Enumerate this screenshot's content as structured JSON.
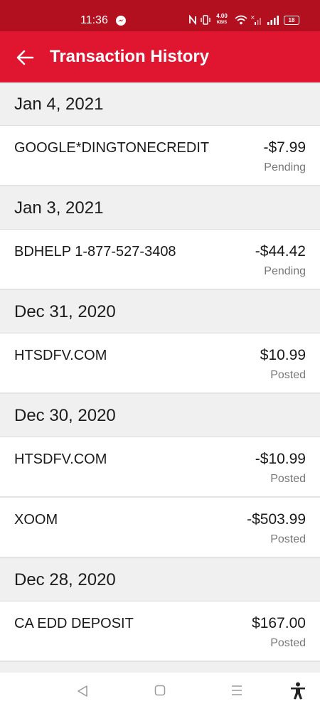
{
  "status_bar": {
    "time": "11:36",
    "net_speed_value": "4.00",
    "net_speed_unit": "KB/S",
    "battery": "18"
  },
  "app_bar": {
    "title": "Transaction History",
    "back_icon": "arrow-left-icon"
  },
  "groups": [
    {
      "date": "Jan 4, 2021",
      "transactions": [
        {
          "merchant": "GOOGLE*DINGTONECREDIT",
          "amount": "-$7.99",
          "status": "Pending"
        }
      ]
    },
    {
      "date": "Jan 3, 2021",
      "transactions": [
        {
          "merchant": "BDHELP 1-877-527-3408",
          "amount": "-$44.42",
          "status": "Pending"
        }
      ]
    },
    {
      "date": "Dec 31, 2020",
      "transactions": [
        {
          "merchant": "HTSDFV.COM",
          "amount": "$10.99",
          "status": "Posted"
        }
      ]
    },
    {
      "date": "Dec 30, 2020",
      "transactions": [
        {
          "merchant": "HTSDFV.COM",
          "amount": "-$10.99",
          "status": "Posted"
        },
        {
          "merchant": "XOOM",
          "amount": "-$503.99",
          "status": "Posted"
        }
      ]
    },
    {
      "date": "Dec 28, 2020",
      "transactions": [
        {
          "merchant": "CA EDD DEPOSIT",
          "amount": "$167.00",
          "status": "Posted"
        }
      ]
    }
  ],
  "nav_bar": {
    "icons": [
      "back-triangle-icon",
      "home-square-icon",
      "menu-lines-icon",
      "accessibility-icon"
    ]
  },
  "colors": {
    "status_bar": "#b3101f",
    "app_bar": "#e0152f",
    "date_header_bg": "#f0f0f0",
    "status_text": "#777777"
  }
}
